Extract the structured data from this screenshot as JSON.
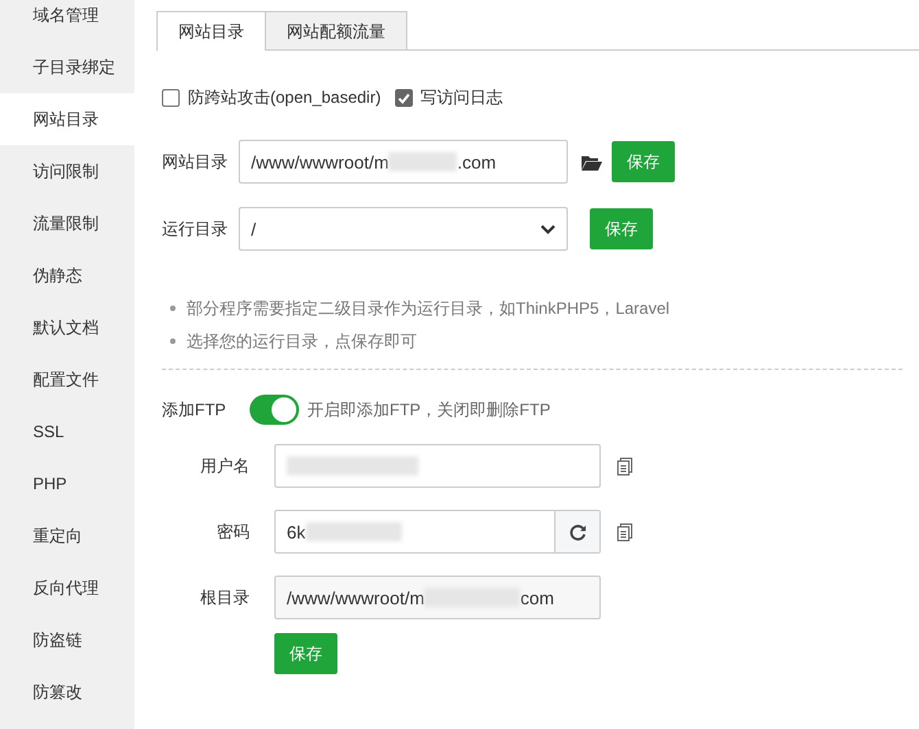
{
  "sidebar": {
    "items": [
      {
        "label": "域名管理",
        "selected": false
      },
      {
        "label": "子目录绑定",
        "selected": false
      },
      {
        "label": "网站目录",
        "selected": true
      },
      {
        "label": "访问限制",
        "selected": false
      },
      {
        "label": "流量限制",
        "selected": false
      },
      {
        "label": "伪静态",
        "selected": false
      },
      {
        "label": "默认文档",
        "selected": false
      },
      {
        "label": "配置文件",
        "selected": false
      },
      {
        "label": "SSL",
        "selected": false
      },
      {
        "label": "PHP",
        "selected": false
      },
      {
        "label": "重定向",
        "selected": false
      },
      {
        "label": "反向代理",
        "selected": false
      },
      {
        "label": "防盗链",
        "selected": false
      },
      {
        "label": "防篡改",
        "selected": false
      }
    ]
  },
  "tabs": [
    {
      "label": "网站目录",
      "selected": true
    },
    {
      "label": "网站配额流量",
      "selected": false
    }
  ],
  "options": [
    {
      "label": "防跨站攻击(open_basedir)",
      "checked": false
    },
    {
      "label": "写访问日志",
      "checked": true
    }
  ],
  "site_dir": {
    "label": "网站目录",
    "value_start": "/www/wwwroot/m",
    "value_end": ".com",
    "button": "保存"
  },
  "run_dir": {
    "label": "运行目录",
    "value": "/",
    "button": "保存"
  },
  "tips": [
    "部分程序需要指定二级目录作为运行目录，如ThinkPHP5，Laravel",
    "选择您的运行目录，点保存即可"
  ],
  "ftp": {
    "label": "添加FTP",
    "on": true,
    "hint": "开启即添加FTP，关闭即删除FTP",
    "fields": [
      {
        "kind": "copy",
        "label": "用户名"
      },
      {
        "kind": "password",
        "label": "密码",
        "value_start": "6k"
      },
      {
        "kind": "readonly",
        "label": "根目录",
        "value_start": "/www/wwwroot/m",
        "value_end": "com"
      }
    ],
    "button": "保存"
  }
}
